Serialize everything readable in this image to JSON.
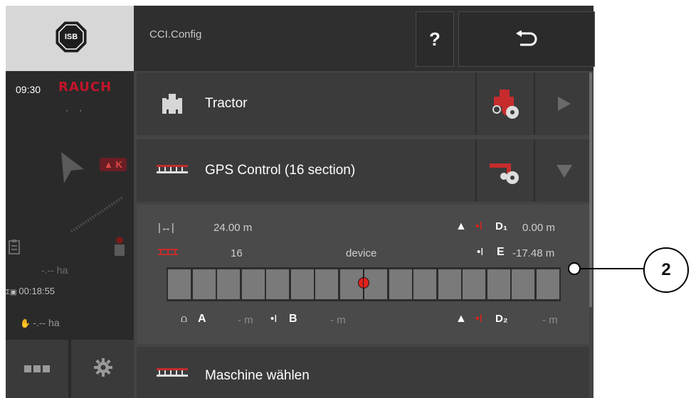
{
  "app": {
    "title": "CCI.Config",
    "logo_text": "ISB"
  },
  "status": {
    "time": "09:30",
    "brand": "RAUCH",
    "dots": "· ·",
    "warning_label": "K",
    "area1": "-.-- ha",
    "timer": "00:18:55",
    "area2": "-.-- ha"
  },
  "toolbar": {
    "help_label": "?",
    "back_label": "↩"
  },
  "rows": {
    "tractor": {
      "label": "Tractor"
    },
    "gps": {
      "label": "GPS Control (16 section)"
    },
    "machine": {
      "label": "Maschine wählen"
    }
  },
  "gps_detail": {
    "width_value": "24.00 m",
    "sections_value": "16",
    "device_label": "device",
    "d1_label": "D₁",
    "d1_value": "0.00 m",
    "e_label": "E",
    "e_value": "-17.48 m",
    "a_label": "A",
    "a_value": "- m",
    "b_label": "B",
    "b_value": "- m",
    "d2_label": "D₂",
    "d2_value": "- m",
    "section_count": 16,
    "device_marker_section": 8
  },
  "callout": {
    "number": "2"
  },
  "colors": {
    "accent_red": "#c2152a",
    "marker_red": "#e0201c",
    "bg_dark": "#444444"
  }
}
